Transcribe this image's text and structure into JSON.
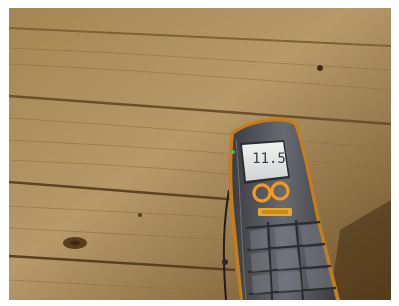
{
  "scene": {
    "description_subject": "moisture-meter",
    "colors": {
      "wood_light": "#b89a66",
      "wood_mid": "#9a7a48",
      "wood_dark": "#5e4420",
      "meter_body": "#5a5d63",
      "meter_accent": "#f29a1e",
      "lcd_bg": "#e6e9e8"
    }
  },
  "meter": {
    "reading": "11.5"
  }
}
